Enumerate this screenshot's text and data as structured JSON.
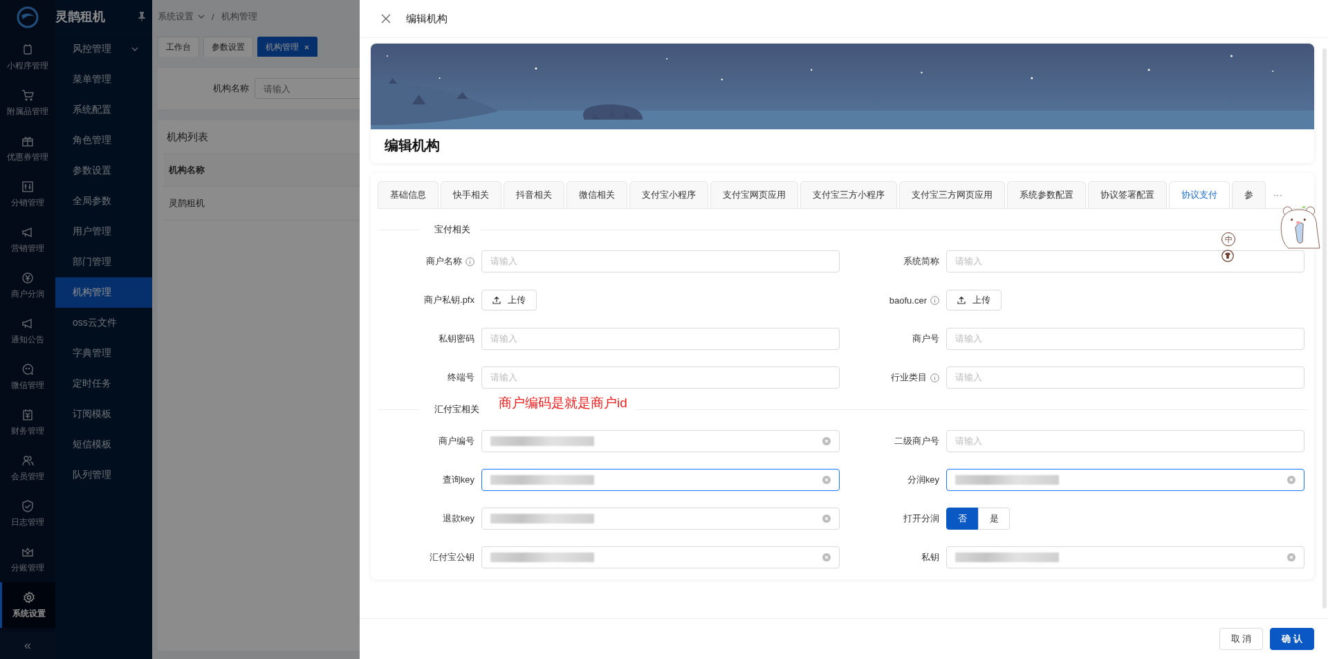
{
  "app": {
    "name": "灵鹊租机",
    "collapse": "«"
  },
  "rail": [
    {
      "label": "小程序管理",
      "selected": false
    },
    {
      "label": "附属品管理",
      "selected": false
    },
    {
      "label": "优惠券管理",
      "selected": false
    },
    {
      "label": "分销管理",
      "selected": false
    },
    {
      "label": "营销管理",
      "selected": false
    },
    {
      "label": "商户分润",
      "selected": false
    },
    {
      "label": "通知公告",
      "selected": false
    },
    {
      "label": "微信管理",
      "selected": false
    },
    {
      "label": "财务管理",
      "selected": false
    },
    {
      "label": "会员管理",
      "selected": false
    },
    {
      "label": "日志管理",
      "selected": false
    },
    {
      "label": "分账管理",
      "selected": false
    },
    {
      "label": "系统设置",
      "selected": true
    }
  ],
  "submenu": [
    {
      "label": "风控管理",
      "selected": false,
      "expandable": true
    },
    {
      "label": "菜单管理",
      "selected": false,
      "expandable": false
    },
    {
      "label": "系统配置",
      "selected": false,
      "expandable": false
    },
    {
      "label": "角色管理",
      "selected": false,
      "expandable": false
    },
    {
      "label": "参数设置",
      "selected": false,
      "expandable": false
    },
    {
      "label": "全局参数",
      "selected": false,
      "expandable": false
    },
    {
      "label": "用户管理",
      "selected": false,
      "expandable": false
    },
    {
      "label": "部门管理",
      "selected": false,
      "expandable": false
    },
    {
      "label": "机构管理",
      "selected": true,
      "expandable": false
    },
    {
      "label": "oss云文件",
      "selected": false,
      "expandable": false
    },
    {
      "label": "字典管理",
      "selected": false,
      "expandable": false
    },
    {
      "label": "定时任务",
      "selected": false,
      "expandable": false
    },
    {
      "label": "订阅模板",
      "selected": false,
      "expandable": false
    },
    {
      "label": "短信模板",
      "selected": false,
      "expandable": false
    },
    {
      "label": "队列管理",
      "selected": false,
      "expandable": false
    }
  ],
  "breadcrumb": [
    "系统设置",
    "机构管理"
  ],
  "breadcrumb_separator": "/",
  "page_tabs": [
    {
      "label": "工作台",
      "selected": false,
      "closable": false
    },
    {
      "label": "参数设置",
      "selected": false,
      "closable": false
    },
    {
      "label": "机构管理",
      "selected": true,
      "closable": true
    }
  ],
  "filter": {
    "label": "机构名称",
    "placeholder": "请输入"
  },
  "list": {
    "title": "机构列表",
    "column": "机构名称",
    "rows": [
      "灵鹊租机"
    ]
  },
  "drawer": {
    "title": "编辑机构",
    "banner_title": "编辑机构",
    "tabs": [
      {
        "label": "基础信息",
        "selected": false
      },
      {
        "label": "快手相关",
        "selected": false
      },
      {
        "label": "抖音相关",
        "selected": false
      },
      {
        "label": "微信相关",
        "selected": false
      },
      {
        "label": "支付宝小程序",
        "selected": false
      },
      {
        "label": "支付宝网页应用",
        "selected": false
      },
      {
        "label": "支付宝三方小程序",
        "selected": false
      },
      {
        "label": "支付宝三方网页应用",
        "selected": false
      },
      {
        "label": "系统参数配置",
        "selected": false
      },
      {
        "label": "协议签署配置",
        "selected": false
      },
      {
        "label": "协议支付",
        "selected": true
      },
      {
        "label": "参",
        "selected": false
      }
    ],
    "tabs_more": "···",
    "sections": [
      {
        "title": "宝付相关",
        "fields": [
          {
            "label": "商户名称",
            "info": true,
            "kind": "input",
            "placeholder": "请输入",
            "filled": false,
            "focused": false
          },
          {
            "label": "系统简称",
            "info": false,
            "kind": "input",
            "placeholder": "请输入",
            "filled": false,
            "focused": false
          },
          {
            "label": "商户私钥.pfx",
            "info": false,
            "kind": "upload",
            "button": "上传"
          },
          {
            "label": "baofu.cer",
            "info": true,
            "kind": "upload",
            "button": "上传"
          },
          {
            "label": "私钥密码",
            "info": false,
            "kind": "input",
            "placeholder": "请输入",
            "filled": false,
            "focused": false
          },
          {
            "label": "商户号",
            "info": false,
            "kind": "input",
            "placeholder": "请输入",
            "filled": false,
            "focused": false
          },
          {
            "label": "终端号",
            "info": false,
            "kind": "input",
            "placeholder": "请输入",
            "filled": false,
            "focused": false
          },
          {
            "label": "行业类目",
            "info": true,
            "kind": "input",
            "placeholder": "请输入",
            "filled": false,
            "focused": false
          }
        ]
      },
      {
        "title": "汇付宝相关",
        "note": "商户编码是就是商户id",
        "fields": [
          {
            "label": "商户编号",
            "info": false,
            "kind": "input",
            "filled": true,
            "focused": false
          },
          {
            "label": "二级商户号",
            "info": false,
            "kind": "input",
            "placeholder": "请输入",
            "filled": false,
            "focused": false
          },
          {
            "label": "查询key",
            "info": false,
            "kind": "input",
            "filled": true,
            "focused": true
          },
          {
            "label": "分润key",
            "info": false,
            "kind": "input",
            "filled": true,
            "focused": true
          },
          {
            "label": "退款key",
            "info": false,
            "kind": "input",
            "filled": true,
            "focused": false
          },
          {
            "label": "打开分润",
            "info": false,
            "kind": "toggle",
            "options": [
              {
                "label": "否",
                "selected": true
              },
              {
                "label": "是",
                "selected": false
              }
            ]
          },
          {
            "label": "汇付宝公钥",
            "info": false,
            "kind": "input",
            "filled": true,
            "focused": false
          },
          {
            "label": "私钥",
            "info": false,
            "kind": "input",
            "filled": true,
            "focused": false
          }
        ]
      }
    ],
    "buttons": [
      {
        "label": "取 消",
        "primary": false
      },
      {
        "label": "确 认",
        "primary": true
      }
    ]
  },
  "ime": {
    "label": "中"
  }
}
